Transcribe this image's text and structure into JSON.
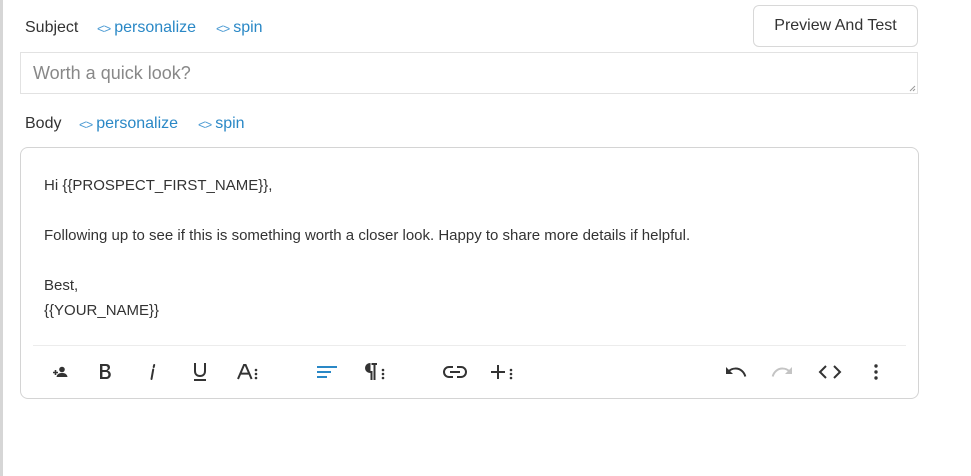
{
  "subject": {
    "label": "Subject",
    "personalize_link": "personalize",
    "spin_link": "spin",
    "value": "Worth a quick look?"
  },
  "preview_button": {
    "label": "Preview And Test"
  },
  "body": {
    "label": "Body",
    "personalize_link": "personalize",
    "spin_link": "spin",
    "lines": [
      "Hi {{PROSPECT_FIRST_NAME}},",
      "",
      "Following up to see if this is something worth a closer look. Happy to share more details if helpful.",
      "",
      "Best,",
      "{{YOUR_NAME}}"
    ]
  },
  "toolbar": {
    "icons": [
      "add-person-icon",
      "bold-icon",
      "italic-icon",
      "underline-icon",
      "font-options-icon",
      "align-left-icon",
      "paragraph-options-icon",
      "link-icon",
      "insert-more-icon",
      "undo-icon",
      "redo-icon",
      "code-view-icon",
      "more-vertical-icon"
    ],
    "colors": {
      "active": "#2a88c6",
      "default": "#333333",
      "disabled": "#c4c4c4"
    }
  }
}
